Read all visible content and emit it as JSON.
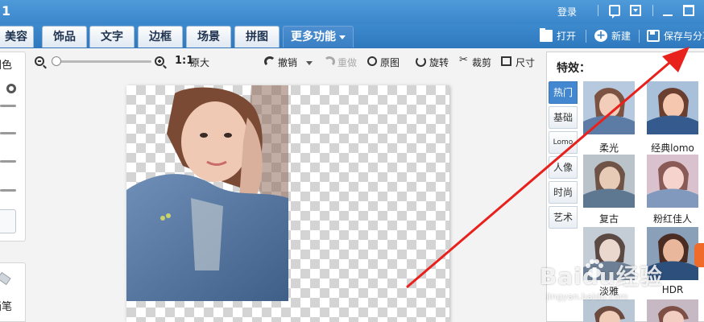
{
  "titlebar": {
    "app_number": "1",
    "login": "登录"
  },
  "tabs": [
    "美容",
    "饰品",
    "文字",
    "边框",
    "场景",
    "拼图"
  ],
  "more_tab": "更多功能",
  "top_actions": {
    "open": "打开",
    "new": "新建",
    "save": "保存与分享"
  },
  "left_panel": {
    "color_label": "调色",
    "pen_label": "画笔"
  },
  "toolbar": {
    "ratio": "1:1",
    "original_size": "原大",
    "undo": "撤销",
    "redo": "重做",
    "original_image": "原图",
    "rotate": "旋转",
    "crop": "裁剪",
    "size": "尺寸",
    "zoom_level": 0.0
  },
  "effects": {
    "title": "特效：",
    "categories": [
      "热门",
      "基础",
      "Lomo",
      "人像",
      "时尚",
      "艺术"
    ],
    "active_category": "热门",
    "items": [
      "柔光",
      "经典lomo",
      "复古",
      "粉红佳人",
      "淡雅",
      "HDR",
      "",
      ""
    ]
  },
  "watermark": {
    "main": "Baidu经验",
    "sub": "jingyan.baidu.com"
  },
  "colors": {
    "accent_blue": "#3b86cb",
    "arrow_red": "#e8211c"
  }
}
